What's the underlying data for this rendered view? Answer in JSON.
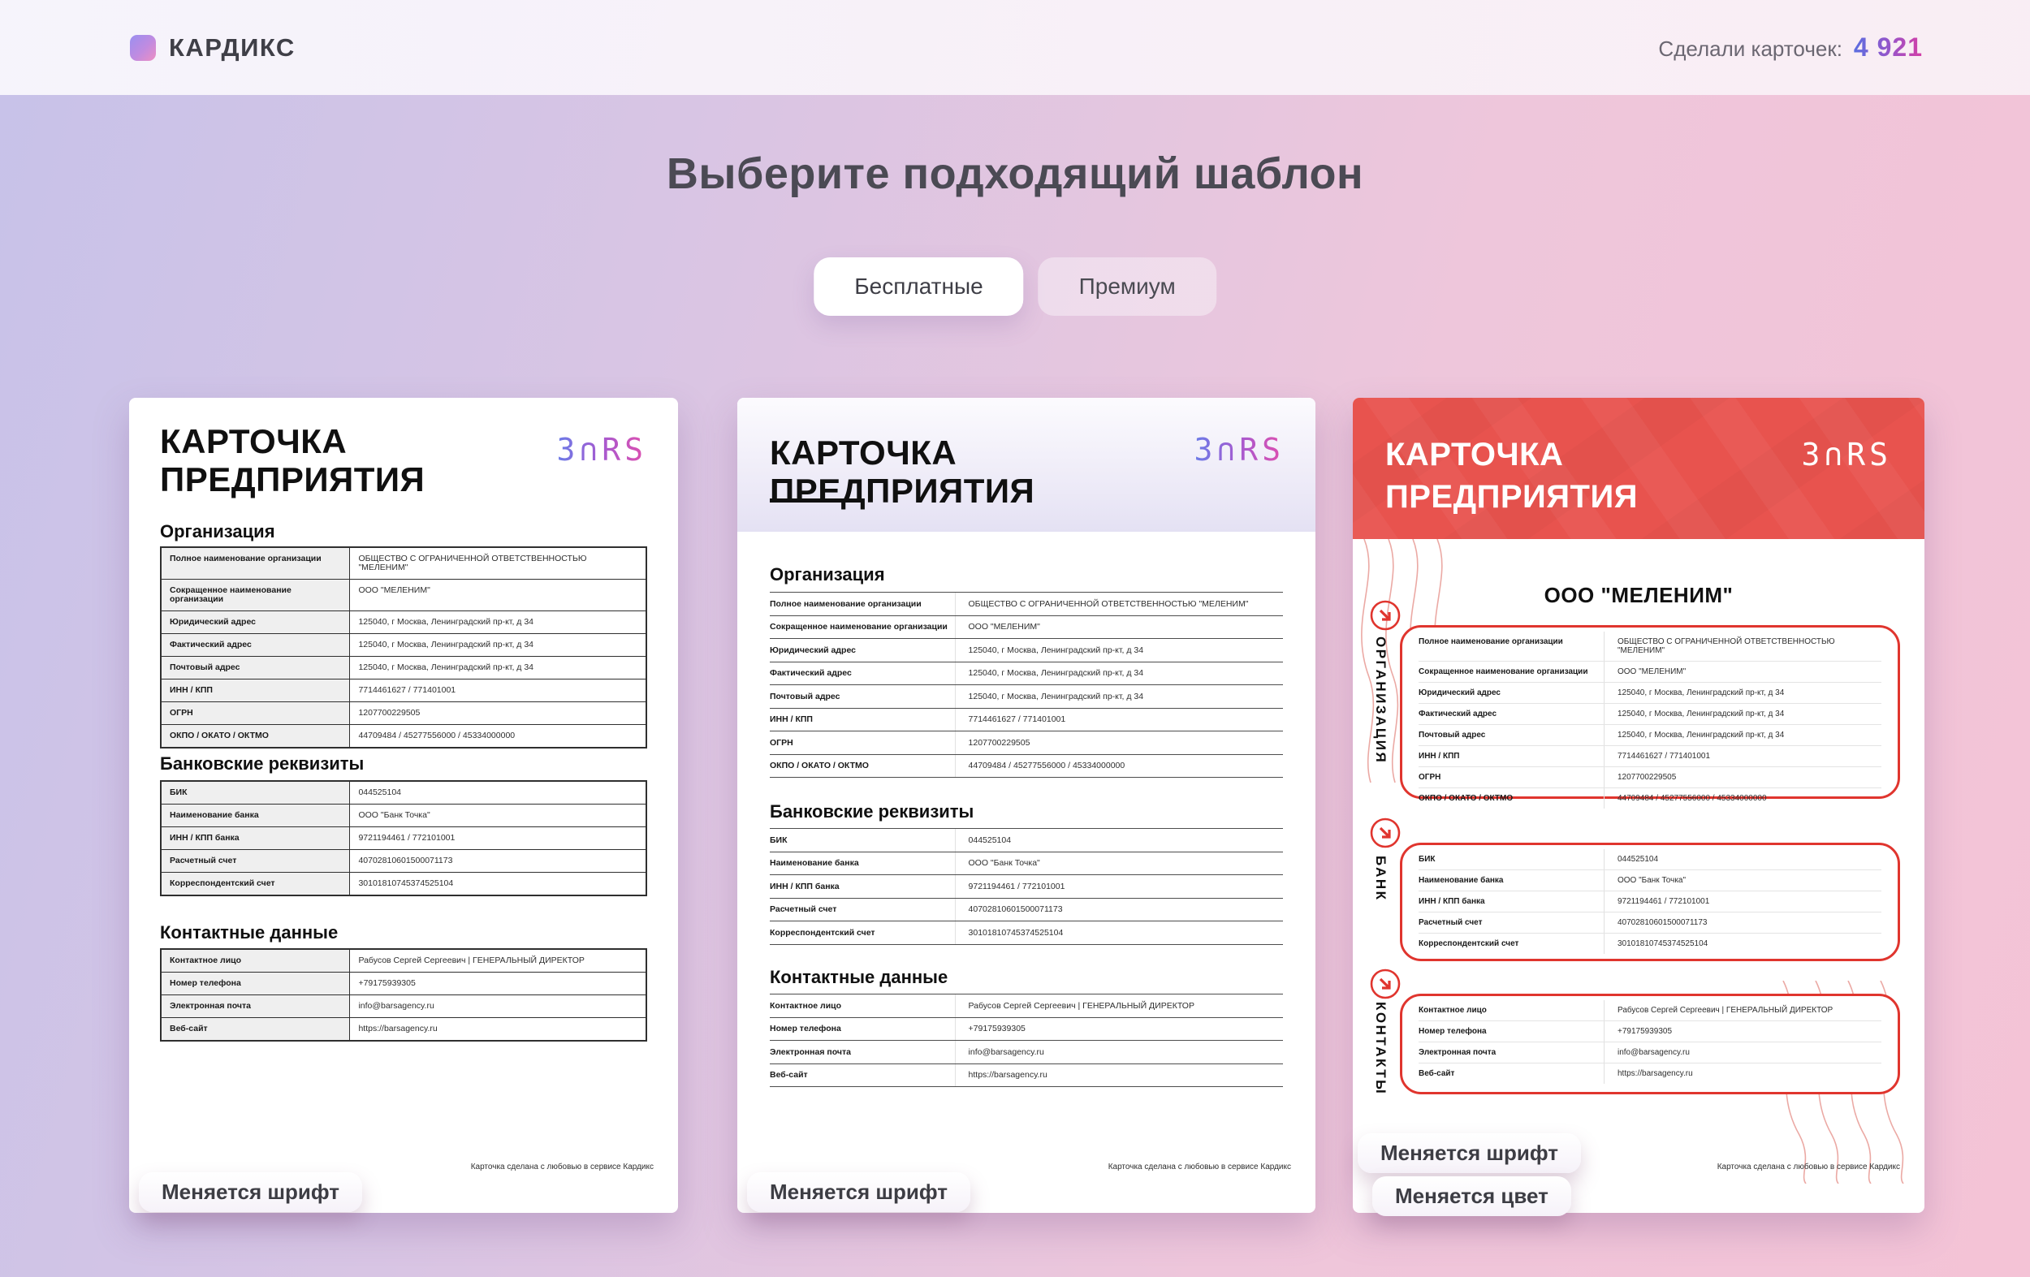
{
  "header": {
    "brand": "КАРДИКС",
    "counter_label": "Сделали карточек:",
    "counter_value": "4 921"
  },
  "page": {
    "title": "Выберите подходящий шаблон",
    "tabs": [
      {
        "label": "Бесплатные",
        "active": true
      },
      {
        "label": "Премиум",
        "active": false
      }
    ]
  },
  "doc": {
    "title_line1": "КАРТОЧКА",
    "title_line2": "ПРЕДПРИЯТИЯ",
    "logo": "3∩RS",
    "org_name": "ООО \"МЕЛЕНИМ\"",
    "footnote": "Карточка сделана с любовью в сервисе Кардикс",
    "sections": [
      {
        "heading": "Организация",
        "rows": [
          {
            "label": "Полное наименование организации",
            "value": "ОБЩЕСТВО С ОГРАНИЧЕННОЙ ОТВЕТСТВЕННОСТЬЮ \"МЕЛЕНИМ\""
          },
          {
            "label": "Сокращенное наименование организации",
            "value": "ООО \"МЕЛЕНИМ\""
          },
          {
            "label": "Юридический адрес",
            "value": "125040, г Москва, Ленинградский пр-кт, д 34"
          },
          {
            "label": "Фактический адрес",
            "value": "125040, г Москва, Ленинградский пр-кт, д 34"
          },
          {
            "label": "Почтовый адрес",
            "value": "125040, г Москва, Ленинградский пр-кт, д 34"
          },
          {
            "label": "ИНН / КПП",
            "value": "7714461627 / 771401001"
          },
          {
            "label": "ОГРН",
            "value": "1207700229505"
          },
          {
            "label": "ОКПО / ОКАТО / ОКТМО",
            "value": "44709484 / 45277556000 / 45334000000"
          }
        ]
      },
      {
        "heading": "Банковские реквизиты",
        "rows": [
          {
            "label": "БИК",
            "value": "044525104"
          },
          {
            "label": "Наименование банка",
            "value": "ООО \"Банк Точка\""
          },
          {
            "label": "ИНН / КПП банка",
            "value": "9721194461 / 772101001"
          },
          {
            "label": "Расчетный счет",
            "value": "40702810601500071173"
          },
          {
            "label": "Корреспондентский счет",
            "value": "30101810745374525104"
          }
        ]
      },
      {
        "heading": "Контактные данные",
        "rows": [
          {
            "label": "Контактное лицо",
            "value": "Рабусов Сергей Сергеевич | ГЕНЕРАЛЬНЫЙ ДИРЕКТОР"
          },
          {
            "label": "Номер телефона",
            "value": "+79175939305"
          },
          {
            "label": "Электронная почта",
            "value": "info@barsagency.ru"
          },
          {
            "label": "Веб-сайт",
            "value": "https://barsagency.ru"
          }
        ]
      }
    ]
  },
  "card3": {
    "side_labels": [
      "ОРГАНИЗАЦИЯ",
      "БАНК",
      "КОНТАКТЫ"
    ]
  },
  "badges": {
    "font": "Меняется шрифт",
    "color": "Меняется цвет"
  },
  "colors": {
    "accent_red": "#e8534e",
    "accent_gradient_from": "#5b6ee0",
    "accent_gradient_to": "#d63fa6"
  },
  "icons": {
    "brand_mark": "gradient-rounded-square",
    "section_arrow": "arrow-down-right-circle"
  }
}
